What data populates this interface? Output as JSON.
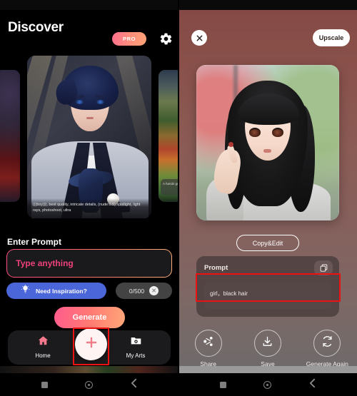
{
  "left": {
    "header": {
      "title": "Discover",
      "pro_label": "PRO",
      "gear_icon": "gear-icon"
    },
    "carousel": {
      "main_caption": "(((boy))), best quality, intricate details, (nude:0.5),spotlight, light rays, photoshoot, ultra",
      "side_right_caption": "A hands grouns"
    },
    "prompt_section": {
      "label": "Enter Prompt",
      "placeholder": "Type anything",
      "value": "",
      "inspiration_label": "Need Inspiration?",
      "inspiration_icon": "lightbulb-icon",
      "counter": "0/500",
      "clear_icon": "close-icon",
      "generate_label": "Generate"
    },
    "bottom_nav": {
      "items": [
        {
          "label": "Home",
          "icon": "home-icon"
        },
        {
          "label": "My Arts",
          "icon": "photo-folder-icon"
        }
      ],
      "fab_icon": "plus-icon"
    }
  },
  "right": {
    "header": {
      "close_icon": "close-icon",
      "upscale_label": "Upscale"
    },
    "copy_edit_label": "Copy&Edit",
    "prompt_card": {
      "title": "Prompt",
      "copy_icon": "copy-icon",
      "value": "girl，black hair"
    },
    "actions": [
      {
        "label": "Share",
        "icon": "share-icon"
      },
      {
        "label": "Save",
        "icon": "download-icon"
      },
      {
        "label": "Generate Again",
        "icon": "refresh-icon"
      }
    ]
  },
  "system_nav": {
    "buttons": [
      "recents-square-icon",
      "home-circle-icon",
      "back-chevron-icon"
    ]
  },
  "colors": {
    "accent_pink": "#ff5b8d",
    "accent_orange": "#ffa878",
    "inspire_blue": "#4a66d8",
    "annotation_red": "#ee1111",
    "right_panel_top": "#854a45"
  }
}
